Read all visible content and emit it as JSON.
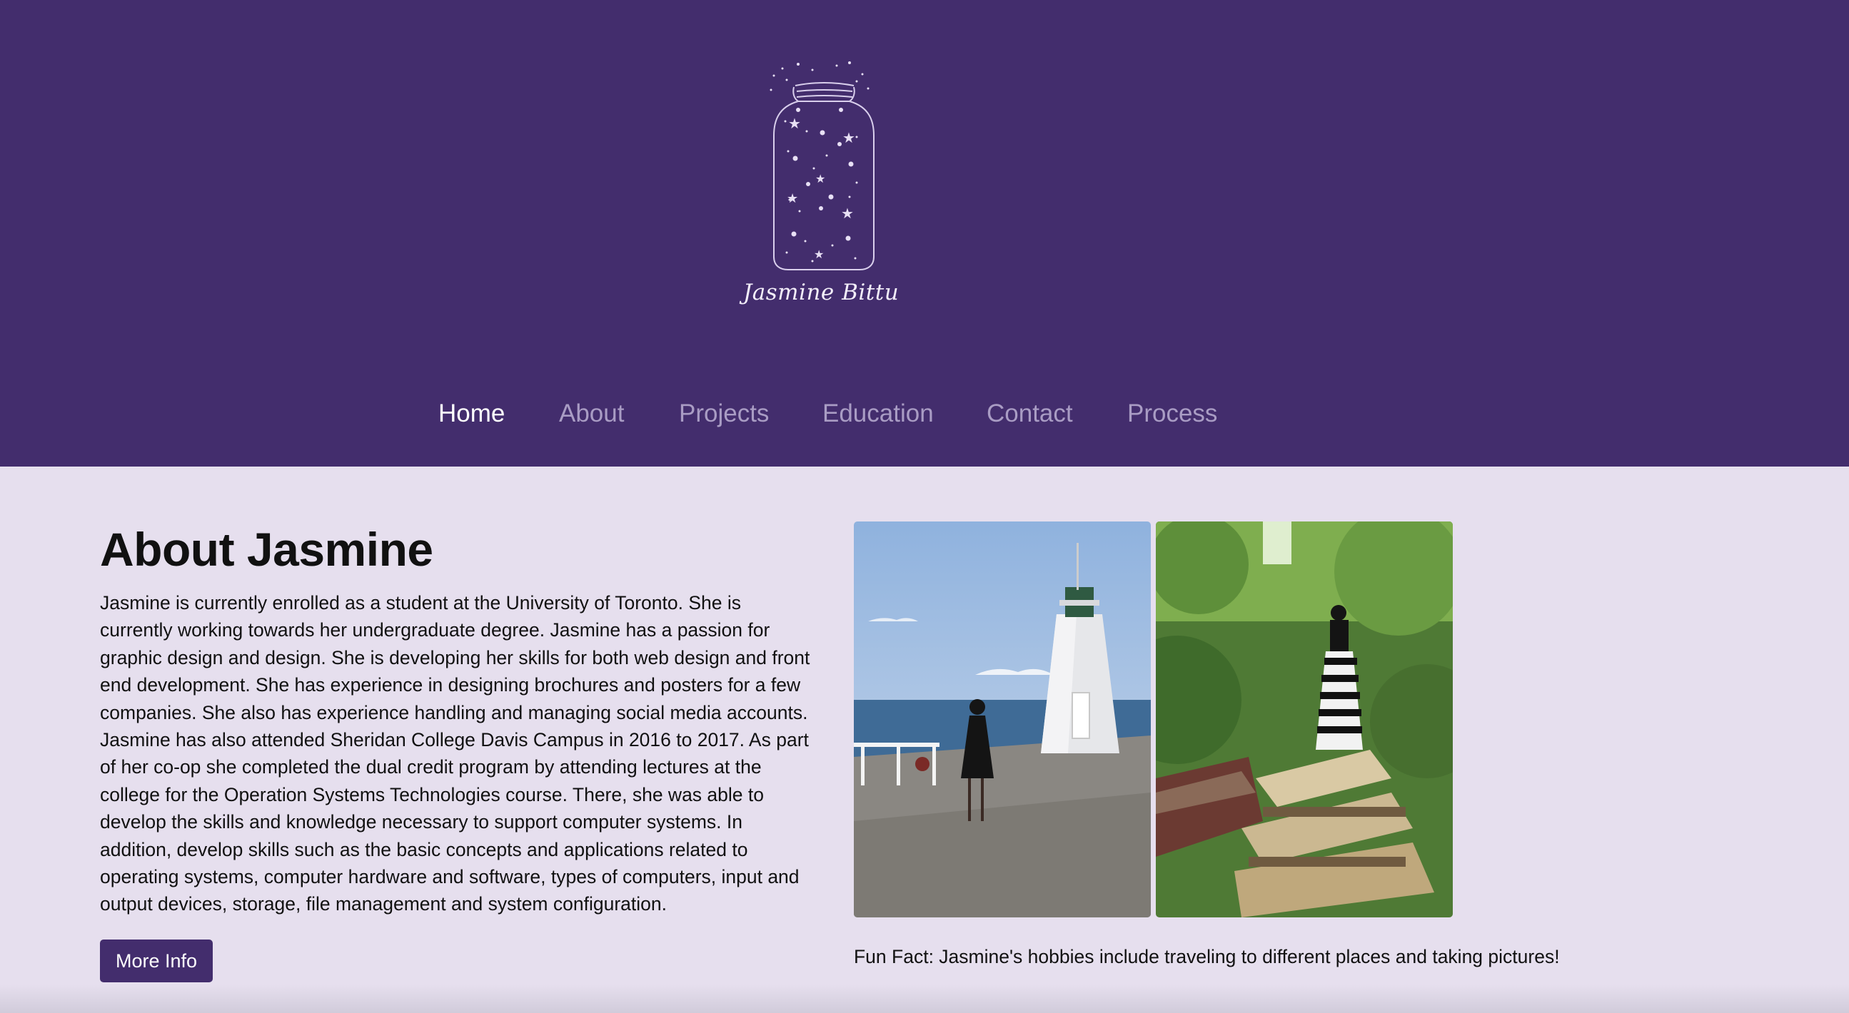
{
  "header": {
    "logo_name": "Jasmine Bittu",
    "logo_icon": "star-jar-icon",
    "background": "#432d6d"
  },
  "nav": {
    "items": [
      {
        "label": "Home",
        "active": true
      },
      {
        "label": "About",
        "active": false
      },
      {
        "label": "Projects",
        "active": false
      },
      {
        "label": "Education",
        "active": false
      },
      {
        "label": "Contact",
        "active": false
      },
      {
        "label": "Process",
        "active": false
      }
    ]
  },
  "about": {
    "title": "About Jasmine",
    "body": "Jasmine is currently enrolled as a student at the University of Toronto. She is currently working towards her undergraduate degree. Jasmine has a passion for graphic design and design. She is developing her skills for both web design and front end development. She has experience in designing brochures and posters for a few companies. She also has experience handling and managing social media accounts. Jasmine has also attended Sheridan College Davis Campus in 2016 to 2017. As part of her co-op she completed the dual credit program by attending lectures at the college for the Operation Systems Technologies course. There, she was able to develop the skills and knowledge necessary to support computer systems. In addition, develop skills such as the basic concepts and applications related to operating systems, computer hardware and software, types of computers, input and output devices, storage, file management and system configuration.",
    "button_label": "More Info"
  },
  "photos": {
    "fun_fact": "Fun Fact: Jasmine's hobbies include traveling to different places and taking pictures!"
  },
  "colors": {
    "accent": "#432d6d",
    "page_background": "#e6dfee",
    "nav_inactive": "#a99cc4"
  }
}
